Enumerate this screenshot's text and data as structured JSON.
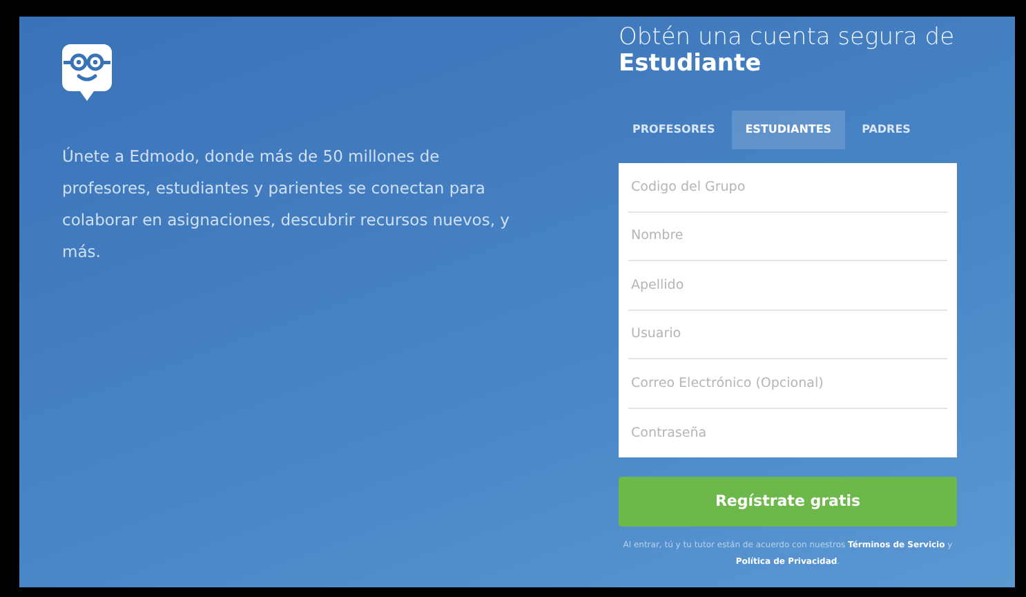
{
  "intro": "Únete a Edmodo, donde más de 50 millones de profesores, estudiantes y parientes se conectan para colaborar en asignaciones, descubrir recursos nuevos, y más.",
  "heading": {
    "line_1": "Obtén una cuenta segura de",
    "line_2": "Estudiante"
  },
  "tabs": [
    {
      "label": "PROFESORES",
      "selected": false
    },
    {
      "label": "ESTUDIANTES",
      "selected": true
    },
    {
      "label": "PADRES",
      "selected": false
    }
  ],
  "fields": [
    {
      "placeholder": "Codigo del Grupo"
    },
    {
      "placeholder": "Nombre"
    },
    {
      "placeholder": "Apellido"
    },
    {
      "placeholder": "Usuario"
    },
    {
      "placeholder": "Correo Electrónico (Opcional)"
    },
    {
      "placeholder": "Contraseña"
    }
  ],
  "submit": "Regístrate gratis",
  "legal": "Al entrar, tú y tu tutor están de acuerdo con nuestros **Términos de Servicio** y **Política de Privacidad**."
}
